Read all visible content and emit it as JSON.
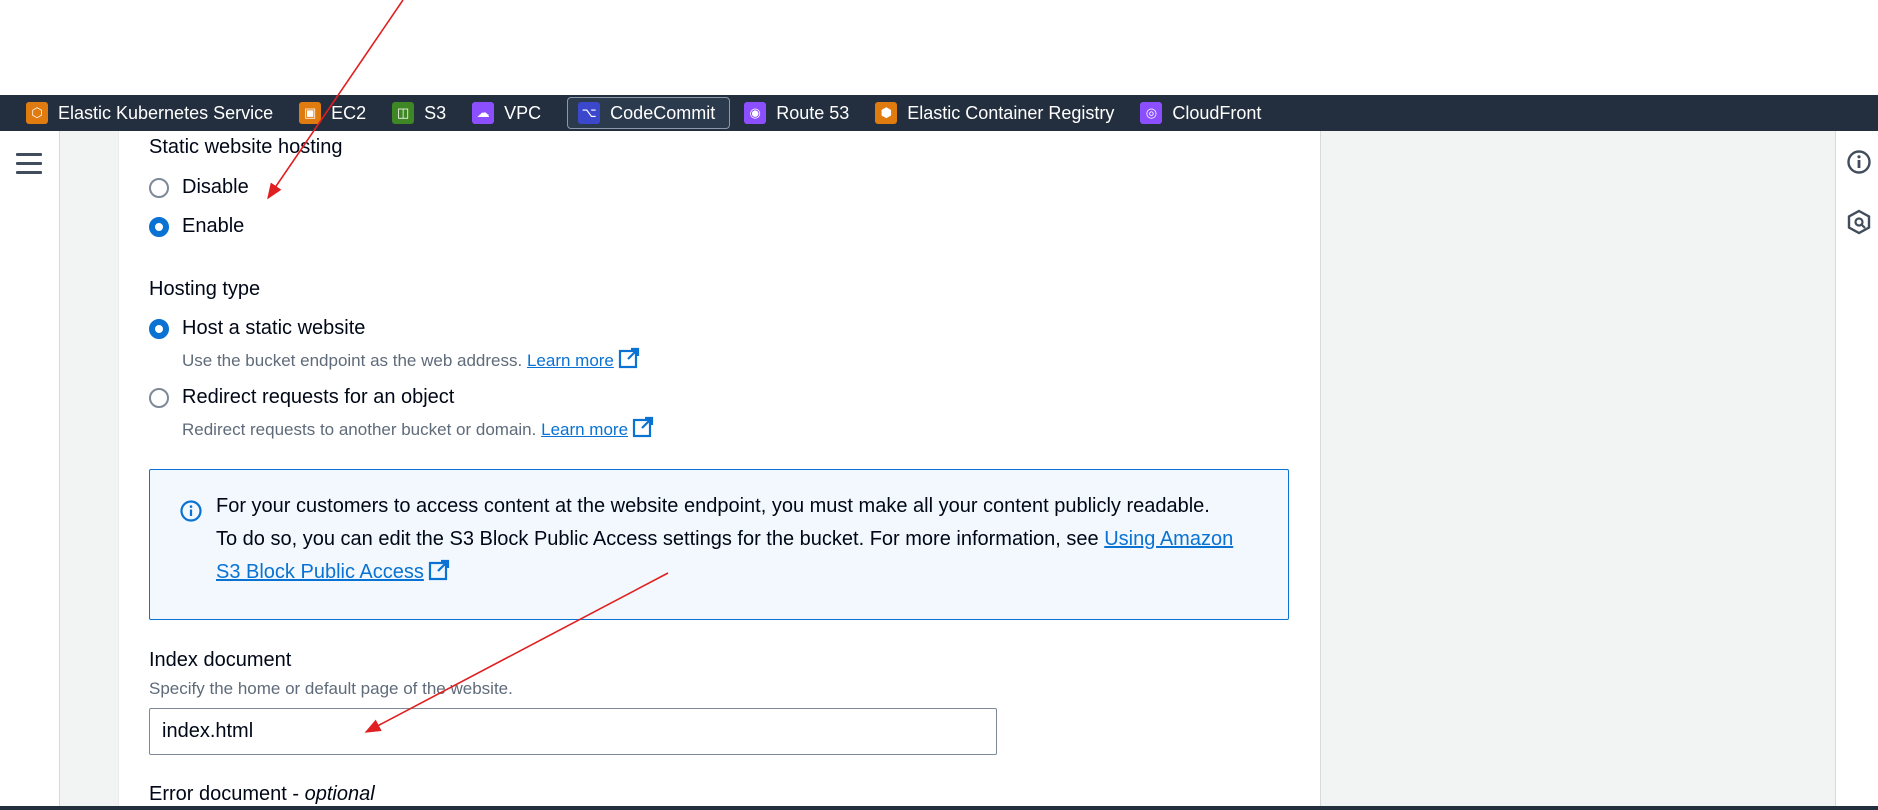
{
  "services": [
    {
      "label": "Elastic Kubernetes Service",
      "color": "#e07b10",
      "icon": "eks-icon"
    },
    {
      "label": "EC2",
      "color": "#e07b10",
      "icon": "ec2-icon"
    },
    {
      "label": "S3",
      "color": "#3f8624",
      "icon": "s3-icon"
    },
    {
      "label": "VPC",
      "color": "#8c4fff",
      "icon": "vpc-icon"
    },
    {
      "label": "CodeCommit",
      "color": "#3b48cc",
      "icon": "codecommit-icon"
    },
    {
      "label": "Route 53",
      "color": "#8c4fff",
      "icon": "route53-icon"
    },
    {
      "label": "Elastic Container Registry",
      "color": "#e07b10",
      "icon": "ecr-icon"
    },
    {
      "label": "CloudFront",
      "color": "#8c4fff",
      "icon": "cloudfront-icon"
    }
  ],
  "static_hosting": {
    "label": "Static website hosting",
    "options": [
      {
        "label": "Disable",
        "selected": false
      },
      {
        "label": "Enable",
        "selected": true
      }
    ]
  },
  "hosting_type": {
    "label": "Hosting type",
    "options": [
      {
        "label": "Host a static website",
        "description": "Use the bucket endpoint as the web address.",
        "link": "Learn more",
        "selected": true
      },
      {
        "label": "Redirect requests for an object",
        "description": "Redirect requests to another bucket or domain.",
        "link": "Learn more",
        "selected": false
      }
    ]
  },
  "info": {
    "text_1": "For your customers to access content at the website endpoint, you must make all your content publicly readable. To do so, you can edit the S3 Block Public Access settings for the bucket. For more information, see",
    "link": "Using Amazon S3 Block Public Access"
  },
  "index_document": {
    "label": "Index document",
    "description": "Specify the home or default page of the website.",
    "value": "index.html"
  },
  "error_document": {
    "label": "Error document -",
    "optional": "optional"
  },
  "colors": {
    "nav_bg": "#232f3e",
    "link": "#0972d3",
    "annotation_arrow": "#e02020"
  }
}
